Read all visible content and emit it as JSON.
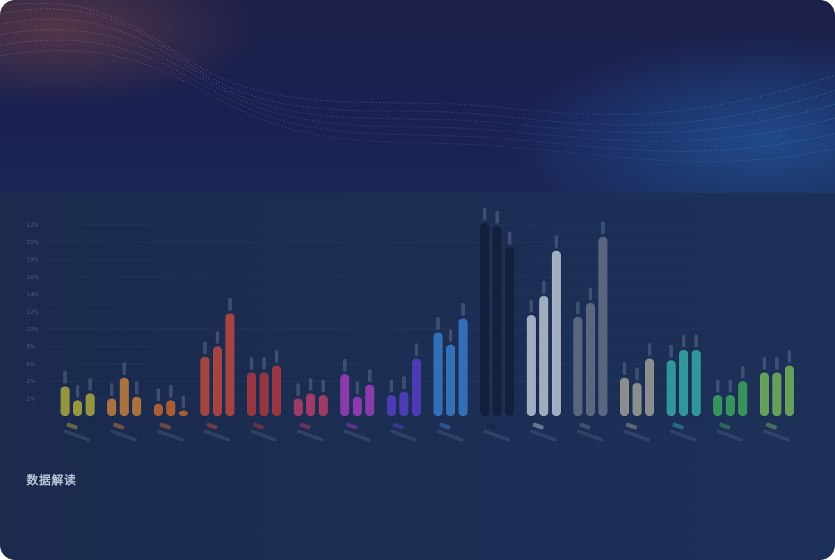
{
  "section": {
    "title": "数据解读",
    "subtitle": "",
    "description": ""
  },
  "colors": {
    "background": "#1b2a4c",
    "grid": "#2a3a5e",
    "tick_text": "#4f5f82"
  },
  "chart_data": {
    "type": "bar",
    "title": "",
    "xlabel": "",
    "ylabel": "",
    "ylim": [
      0,
      110
    ],
    "grid": true,
    "y_ticks": [
      "2%",
      "4%",
      "6%",
      "8%",
      "10%",
      "12%",
      "14%",
      "16%",
      "18%",
      "20%",
      "22%"
    ],
    "categories": [
      "",
      "",
      "",
      "",
      "",
      "",
      "",
      "",
      "",
      "",
      "",
      "",
      "",
      "",
      "",
      "",
      ""
    ],
    "series_colors": [
      "#b8b33b",
      "#d1853b",
      "#d46a2d",
      "#c94b3f",
      "#b83a3c",
      "#c03f6b",
      "#a63fc4",
      "#5a3fd0",
      "#3a82d4",
      "#0f1a30",
      "#c6cfe0",
      "#6c7589",
      "#a9a89e",
      "#36b4ac",
      "#3faf5d",
      "#7bbf5a"
    ],
    "groups": [
      {
        "color": "#b8b33b",
        "values": [
          17,
          9,
          13
        ]
      },
      {
        "color": "#d1853b",
        "values": [
          10,
          22,
          11
        ]
      },
      {
        "color": "#d46a2d",
        "values": [
          7,
          9,
          3
        ]
      },
      {
        "color": "#c94b3f",
        "values": [
          34,
          40,
          59
        ]
      },
      {
        "color": "#b83a3c",
        "values": [
          25,
          25,
          29
        ]
      },
      {
        "color": "#c03f6b",
        "values": [
          10,
          13,
          12
        ]
      },
      {
        "color": "#a63fc4",
        "values": [
          24,
          11,
          18
        ]
      },
      {
        "color": "#5a3fd0",
        "values": [
          12,
          14,
          33
        ]
      },
      {
        "color": "#3a82d4",
        "values": [
          48,
          41,
          56
        ]
      },
      {
        "color": "#101c34",
        "values": [
          111,
          109,
          97
        ]
      },
      {
        "color": "#c6cfe0",
        "values": [
          58,
          69,
          95
        ]
      },
      {
        "color": "#6c7589",
        "values": [
          57,
          65,
          103
        ]
      },
      {
        "color": "#a9a89e",
        "values": [
          22,
          19,
          33
        ]
      },
      {
        "color": "#36b4ac",
        "values": [
          32,
          38,
          38
        ]
      },
      {
        "color": "#3faf5d",
        "values": [
          12,
          12,
          20
        ]
      },
      {
        "color": "#7bbf5a",
        "values": [
          25,
          25,
          29
        ]
      }
    ]
  }
}
